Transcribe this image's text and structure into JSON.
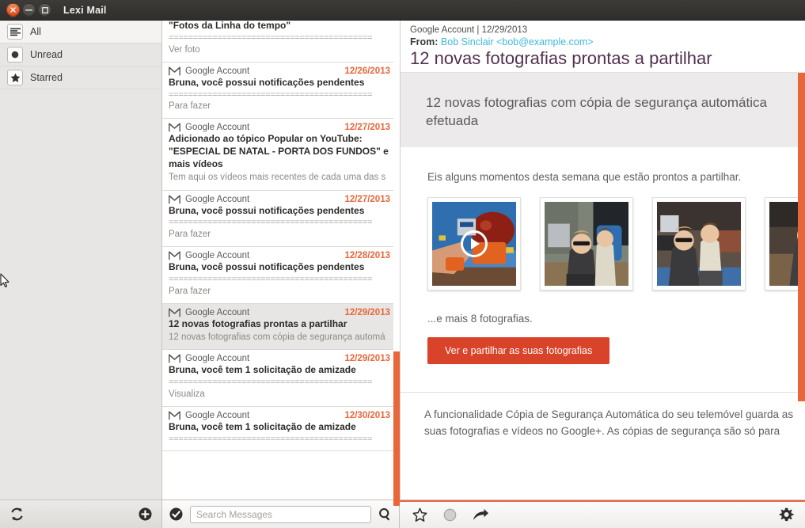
{
  "window": {
    "title": "Lexi Mail",
    "controls": {
      "close": "close-button",
      "minimize": "minimize-button",
      "maximize": "maximize-button"
    }
  },
  "sidebar": {
    "items": [
      {
        "label": "All",
        "icon": "list-icon",
        "selected": true
      },
      {
        "label": "Unread",
        "icon": "dot-icon",
        "selected": false
      },
      {
        "label": "Starred",
        "icon": "star-icon",
        "selected": false
      }
    ]
  },
  "message_list": {
    "messages": [
      {
        "sender": "",
        "date": "",
        "subject": "André Santos adicionou uma nova foto ao álbum \"Fotos da Linha do tempo\"",
        "separator": "==========================================",
        "snippet": "Ver foto",
        "selected": false,
        "clipped": true
      },
      {
        "sender": "Google Account",
        "date": "12/26/2013",
        "subject": "Bruna, você possui notificações pendentes",
        "separator": "==========================================",
        "snippet": "Para fazer",
        "selected": false,
        "clipped": false
      },
      {
        "sender": "Google Account",
        "date": "12/27/2013",
        "subject": "Adicionado ao tópico Popular on YouTube: \"ESPECIAL DE NATAL - PORTA DOS FUNDOS\" e mais vídeos",
        "separator": "",
        "snippet": "Tem aqui os vídeos mais recentes de cada uma das s",
        "selected": false,
        "clipped": false
      },
      {
        "sender": "Google Account",
        "date": "12/27/2013",
        "subject": "Bruna, você possui notificações pendentes",
        "separator": "==========================================",
        "snippet": "Para fazer",
        "selected": false,
        "clipped": false
      },
      {
        "sender": "Google Account",
        "date": "12/28/2013",
        "subject": "Bruna, você possui notificações pendentes",
        "separator": "==========================================",
        "snippet": "Para fazer",
        "selected": false,
        "clipped": false
      },
      {
        "sender": "Google Account",
        "date": "12/29/2013",
        "subject": "12 novas fotografias prontas a partilhar",
        "separator": "",
        "snippet": "12 novas fotografias com cópia de segurança automá",
        "selected": true,
        "clipped": false
      },
      {
        "sender": "Google Account",
        "date": "12/29/2013",
        "subject": "Bruna, você tem 1 solicitação de amizade",
        "separator": "==========================================",
        "snippet": "Visualiza",
        "selected": false,
        "clipped": false
      },
      {
        "sender": "Google Account",
        "date": "12/30/2013",
        "subject": "Bruna, você tem 1 solicitação de amizade",
        "separator": "==========================================",
        "snippet": "",
        "selected": false,
        "clipped": false
      }
    ]
  },
  "reading_pane": {
    "meta": "Google Account | 12/29/2013",
    "from_label": "From:",
    "from_value": "Bob Sinclair <bob@example.com>",
    "subject": "12 novas fotografias prontas a partilhar",
    "email": {
      "banner_title": "12 novas fotografias com cópia de segurança automática efetuada",
      "lead": "Eis alguns momentos desta semana que estão prontos a partilhar.",
      "more_text": "...e mais 8 fotografias.",
      "cta_label": "Ver e partilhar as suas fotografias",
      "footer_text": "A funcionalidade Cópia de Segurança Automática do seu telemóvel guarda as suas fotografias e vídeos no Google+. As cópias de segurança são só para"
    }
  },
  "toolbar": {
    "refresh": "refresh-icon",
    "add": "add-icon",
    "mark_read": "mark-read-icon",
    "search_placeholder": "Search Messages",
    "search_value": "",
    "search_submit": "search-icon",
    "star": "star-icon",
    "unread_toggle": "circle-icon",
    "forward": "forward-icon",
    "settings": "gear-icon"
  },
  "colors": {
    "accent": "#e8663a",
    "cta": "#d8432a",
    "link": "#3fb8d8",
    "subject": "#52304f",
    "titlebar": "#3d3b38"
  }
}
